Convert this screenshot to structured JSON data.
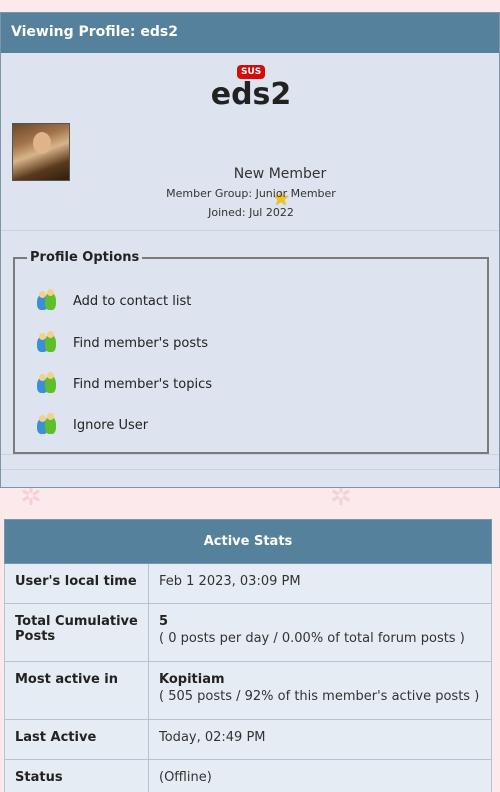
{
  "profile": {
    "header_title": "Viewing Profile: eds2",
    "badge": "SUS",
    "username": "eds2",
    "rank": "New Member",
    "member_group": "Member Group: Junior Member",
    "joined": "Joined: Jul 2022"
  },
  "options": {
    "legend": "Profile Options",
    "items": [
      {
        "label": "Add to contact list",
        "icon": "contacts-icon"
      },
      {
        "label": "Find member's posts",
        "icon": "contacts-icon"
      },
      {
        "label": "Find member's topics",
        "icon": "contacts-icon"
      },
      {
        "label": "Ignore User",
        "icon": "contacts-icon"
      }
    ]
  },
  "stats": {
    "title": "Active Stats",
    "rows": [
      {
        "label": "User's local time",
        "value": "Feb 1 2023, 03:09 PM",
        "sub": ""
      },
      {
        "label": "Total Cumulative Posts",
        "value": "5",
        "sub": "( 0 posts per day / 0.00% of total forum posts )"
      },
      {
        "label": "Most active in",
        "value": "Kopitiam",
        "sub": "( 505 posts / 92% of this member's active posts )"
      },
      {
        "label": "Last Active",
        "value": "Today, 02:49 PM",
        "sub": ""
      },
      {
        "label": "Status",
        "value": "(Offline)",
        "sub": ""
      }
    ]
  },
  "colors": {
    "header_bg": "#56819d",
    "panel_bg": "#dde4ef",
    "badge_bg": "#d40c0c",
    "page_bg": "#fbe9ec"
  }
}
